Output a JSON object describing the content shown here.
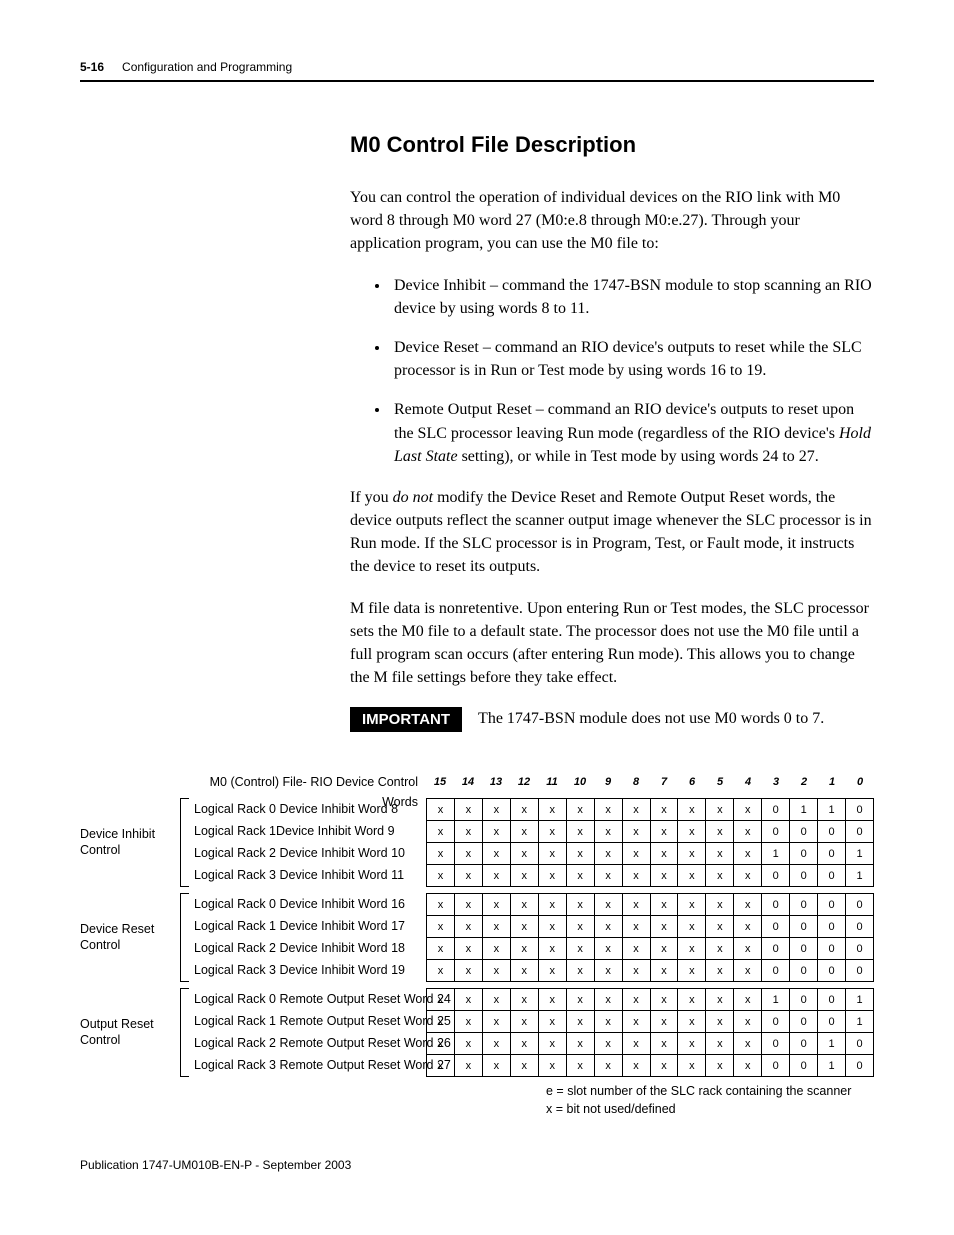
{
  "header": {
    "page_num": "5-16",
    "chapter": "Configuration and Programming"
  },
  "title": "M0 Control File Description",
  "intro": "You can control the operation of individual devices on the RIO link with M0 word 8 through M0 word 27 (M0:e.8 through M0:e.27). Through your application program, you can use the M0 file to:",
  "bullets": [
    "Device Inhibit – command the 1747-BSN module to stop scanning an RIO device by using words 8 to 11.",
    "Device Reset – command an RIO device's outputs to reset while the SLC processor is in Run or Test mode by using words 16 to 19.",
    "Remote Output Reset – command an RIO device's outputs to reset upon the SLC processor leaving Run mode (regardless of the RIO device's Hold Last State setting), or while in Test mode by using words 24 to 27."
  ],
  "para2_a": "If you ",
  "para2_b": "do not",
  "para2_c": " modify the Device Reset and Remote Output Reset words, the device outputs reflect the scanner output image whenever the SLC processor is in Run mode. If the SLC processor is in Program, Test, or Fault mode, it instructs the device to reset its outputs.",
  "para3": "M file data is nonretentive. Upon entering Run or Test modes, the SLC processor sets the M0 file to a default state. The processor does not use the M0 file until a full program scan occurs (after entering Run mode). This allows you to change the M file settings before they take effect.",
  "important_label": "IMPORTANT",
  "important_text": "The 1747-BSN module does not use M0 words 0 to 7.",
  "diagram": {
    "title": "M0 (Control) File- RIO Device Control Words",
    "bit_headers": [
      "15",
      "14",
      "13",
      "12",
      "11",
      "10",
      "9",
      "8",
      "7",
      "6",
      "5",
      "4",
      "3",
      "2",
      "1",
      "0"
    ],
    "groups": [
      {
        "label": "Device Inhibit Control",
        "rows": [
          {
            "text": "Logical Rack 0 Device Inhibit Word 8",
            "bits": [
              "x",
              "x",
              "x",
              "x",
              "x",
              "x",
              "x",
              "x",
              "x",
              "x",
              "x",
              "x",
              "0",
              "1",
              "1",
              "0"
            ]
          },
          {
            "text": "Logical Rack 1Device Inhibit Word 9",
            "bits": [
              "x",
              "x",
              "x",
              "x",
              "x",
              "x",
              "x",
              "x",
              "x",
              "x",
              "x",
              "x",
              "0",
              "0",
              "0",
              "0"
            ]
          },
          {
            "text": "Logical Rack 2 Device Inhibit Word 10",
            "bits": [
              "x",
              "x",
              "x",
              "x",
              "x",
              "x",
              "x",
              "x",
              "x",
              "x",
              "x",
              "x",
              "1",
              "0",
              "0",
              "1"
            ]
          },
          {
            "text": "Logical Rack 3 Device Inhibit Word 11",
            "bits": [
              "x",
              "x",
              "x",
              "x",
              "x",
              "x",
              "x",
              "x",
              "x",
              "x",
              "x",
              "x",
              "0",
              "0",
              "0",
              "1"
            ]
          }
        ]
      },
      {
        "label": "Device Reset Control",
        "rows": [
          {
            "text": "Logical Rack 0 Device Inhibit Word 16",
            "bits": [
              "x",
              "x",
              "x",
              "x",
              "x",
              "x",
              "x",
              "x",
              "x",
              "x",
              "x",
              "x",
              "0",
              "0",
              "0",
              "0"
            ]
          },
          {
            "text": "Logical Rack 1 Device Inhibit Word 17",
            "bits": [
              "x",
              "x",
              "x",
              "x",
              "x",
              "x",
              "x",
              "x",
              "x",
              "x",
              "x",
              "x",
              "0",
              "0",
              "0",
              "0"
            ]
          },
          {
            "text": "Logical Rack 2 Device Inhibit Word 18",
            "bits": [
              "x",
              "x",
              "x",
              "x",
              "x",
              "x",
              "x",
              "x",
              "x",
              "x",
              "x",
              "x",
              "0",
              "0",
              "0",
              "0"
            ]
          },
          {
            "text": "Logical Rack 3 Device Inhibit Word 19",
            "bits": [
              "x",
              "x",
              "x",
              "x",
              "x",
              "x",
              "x",
              "x",
              "x",
              "x",
              "x",
              "x",
              "0",
              "0",
              "0",
              "0"
            ]
          }
        ]
      },
      {
        "label": "Output Reset Control",
        "rows": [
          {
            "text": "Logical Rack 0 Remote Output Reset Word 24",
            "bits": [
              "x",
              "x",
              "x",
              "x",
              "x",
              "x",
              "x",
              "x",
              "x",
              "x",
              "x",
              "x",
              "1",
              "0",
              "0",
              "1"
            ]
          },
          {
            "text": "Logical Rack 1 Remote Output Reset Word 25",
            "bits": [
              "x",
              "x",
              "x",
              "x",
              "x",
              "x",
              "x",
              "x",
              "x",
              "x",
              "x",
              "x",
              "0",
              "0",
              "0",
              "1"
            ]
          },
          {
            "text": "Logical Rack 2 Remote Output Reset Word 26",
            "bits": [
              "x",
              "x",
              "x",
              "x",
              "x",
              "x",
              "x",
              "x",
              "x",
              "x",
              "x",
              "x",
              "0",
              "0",
              "1",
              "0"
            ]
          },
          {
            "text": "Logical Rack 3 Remote Output Reset Word 27",
            "bits": [
              "x",
              "x",
              "x",
              "x",
              "x",
              "x",
              "x",
              "x",
              "x",
              "x",
              "x",
              "x",
              "0",
              "0",
              "1",
              "0"
            ]
          }
        ]
      }
    ],
    "note1": "e = slot number of the SLC rack containing the scanner",
    "note2": "x = bit not used/defined"
  },
  "footer": "Publication 1747-UM010B-EN-P - September 2003",
  "chart_data": {
    "type": "table",
    "title": "M0 (Control) File - RIO Device Control Words",
    "columns": [
      "15",
      "14",
      "13",
      "12",
      "11",
      "10",
      "9",
      "8",
      "7",
      "6",
      "5",
      "4",
      "3",
      "2",
      "1",
      "0"
    ],
    "sections": [
      {
        "name": "Device Inhibit Control",
        "rows": [
          {
            "label": "Logical Rack 0 Device Inhibit Word 8",
            "values": [
              "x",
              "x",
              "x",
              "x",
              "x",
              "x",
              "x",
              "x",
              "x",
              "x",
              "x",
              "x",
              "0",
              "1",
              "1",
              "0"
            ]
          },
          {
            "label": "Logical Rack 1 Device Inhibit Word 9",
            "values": [
              "x",
              "x",
              "x",
              "x",
              "x",
              "x",
              "x",
              "x",
              "x",
              "x",
              "x",
              "x",
              "0",
              "0",
              "0",
              "0"
            ]
          },
          {
            "label": "Logical Rack 2 Device Inhibit Word 10",
            "values": [
              "x",
              "x",
              "x",
              "x",
              "x",
              "x",
              "x",
              "x",
              "x",
              "x",
              "x",
              "x",
              "1",
              "0",
              "0",
              "1"
            ]
          },
          {
            "label": "Logical Rack 3 Device Inhibit Word 11",
            "values": [
              "x",
              "x",
              "x",
              "x",
              "x",
              "x",
              "x",
              "x",
              "x",
              "x",
              "x",
              "x",
              "0",
              "0",
              "0",
              "1"
            ]
          }
        ]
      },
      {
        "name": "Device Reset Control",
        "rows": [
          {
            "label": "Logical Rack 0 Device Inhibit Word 16",
            "values": [
              "x",
              "x",
              "x",
              "x",
              "x",
              "x",
              "x",
              "x",
              "x",
              "x",
              "x",
              "x",
              "0",
              "0",
              "0",
              "0"
            ]
          },
          {
            "label": "Logical Rack 1 Device Inhibit Word 17",
            "values": [
              "x",
              "x",
              "x",
              "x",
              "x",
              "x",
              "x",
              "x",
              "x",
              "x",
              "x",
              "x",
              "0",
              "0",
              "0",
              "0"
            ]
          },
          {
            "label": "Logical Rack 2 Device Inhibit Word 18",
            "values": [
              "x",
              "x",
              "x",
              "x",
              "x",
              "x",
              "x",
              "x",
              "x",
              "x",
              "x",
              "x",
              "0",
              "0",
              "0",
              "0"
            ]
          },
          {
            "label": "Logical Rack 3 Device Inhibit Word 19",
            "values": [
              "x",
              "x",
              "x",
              "x",
              "x",
              "x",
              "x",
              "x",
              "x",
              "x",
              "x",
              "x",
              "0",
              "0",
              "0",
              "0"
            ]
          }
        ]
      },
      {
        "name": "Output Reset Control",
        "rows": [
          {
            "label": "Logical Rack 0 Remote Output Reset Word 24",
            "values": [
              "x",
              "x",
              "x",
              "x",
              "x",
              "x",
              "x",
              "x",
              "x",
              "x",
              "x",
              "x",
              "1",
              "0",
              "0",
              "1"
            ]
          },
          {
            "label": "Logical Rack 1 Remote Output Reset Word 25",
            "values": [
              "x",
              "x",
              "x",
              "x",
              "x",
              "x",
              "x",
              "x",
              "x",
              "x",
              "x",
              "x",
              "0",
              "0",
              "0",
              "1"
            ]
          },
          {
            "label": "Logical Rack 2 Remote Output Reset Word 26",
            "values": [
              "x",
              "x",
              "x",
              "x",
              "x",
              "x",
              "x",
              "x",
              "x",
              "x",
              "x",
              "x",
              "0",
              "0",
              "1",
              "0"
            ]
          },
          {
            "label": "Logical Rack 3 Remote Output Reset Word 27",
            "values": [
              "x",
              "x",
              "x",
              "x",
              "x",
              "x",
              "x",
              "x",
              "x",
              "x",
              "x",
              "x",
              "0",
              "0",
              "1",
              "0"
            ]
          }
        ]
      }
    ],
    "legend": [
      "e = slot number of the SLC rack containing the scanner",
      "x = bit not used/defined"
    ]
  }
}
